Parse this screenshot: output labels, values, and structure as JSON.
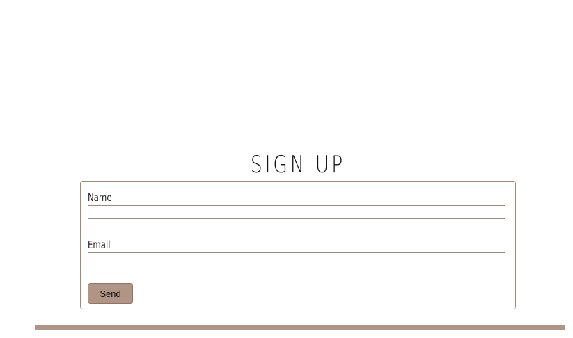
{
  "signup": {
    "title": "SIGN UP",
    "name_label": "Name",
    "name_value": "",
    "email_label": "Email",
    "email_value": "",
    "send_label": "Send"
  },
  "colors": {
    "accent": "#b09584",
    "border": "#a08872",
    "text": "#111111",
    "background": "#ffffff"
  }
}
